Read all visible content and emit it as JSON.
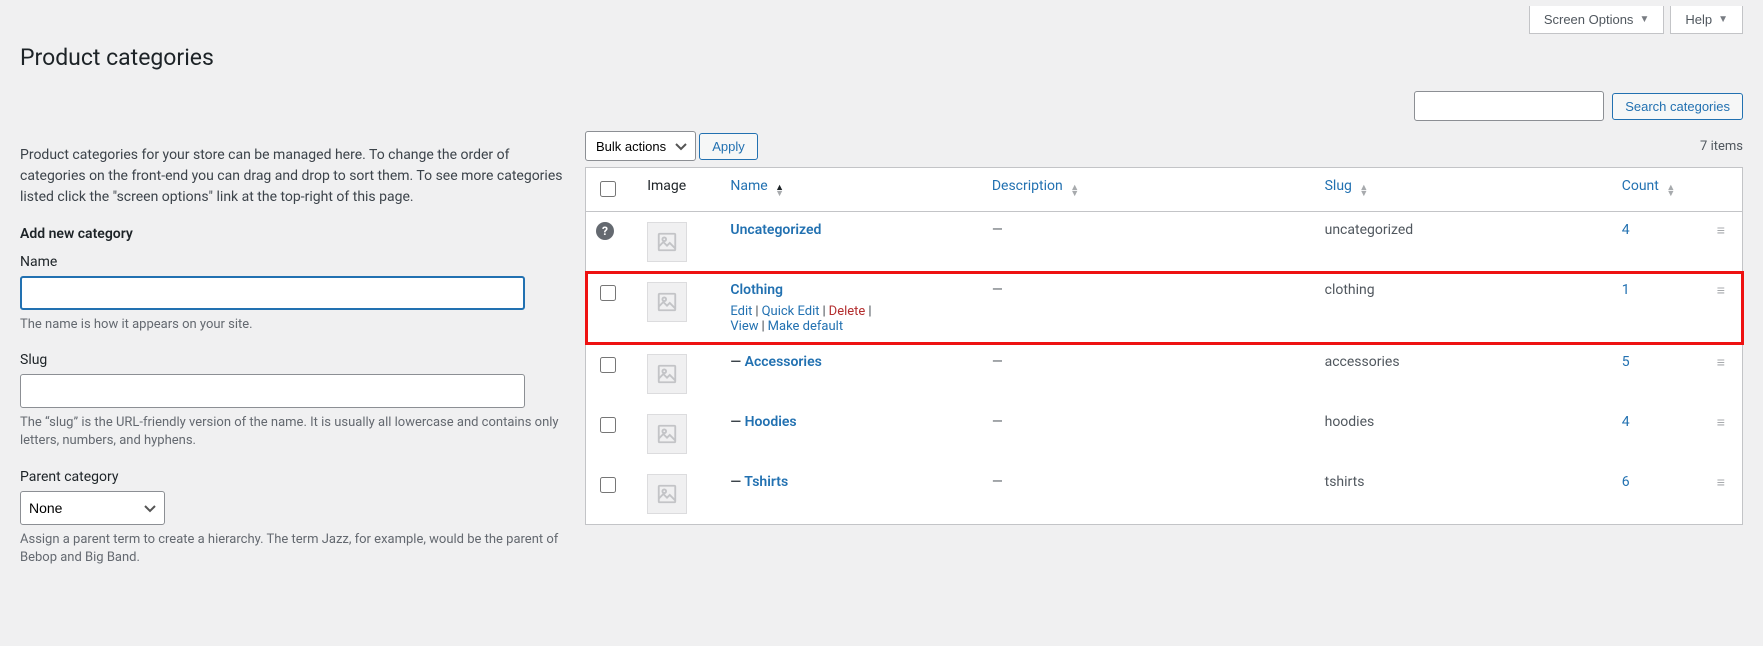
{
  "top": {
    "screen_options": "Screen Options",
    "help": "Help"
  },
  "page_title": "Product categories",
  "search": {
    "button": "Search categories"
  },
  "intro": "Product categories for your store can be managed here. To change the order of categories on the front-end you can drag and drop to sort them. To see more categories listed click the \"screen options\" link at the top-right of this page.",
  "form": {
    "heading": "Add new category",
    "name_label": "Name",
    "name_hint": "The name is how it appears on your site.",
    "slug_label": "Slug",
    "slug_hint": "The “slug” is the URL-friendly version of the name. It is usually all lowercase and contains only letters, numbers, and hyphens.",
    "parent_label": "Parent category",
    "parent_selected": "None",
    "parent_hint": "Assign a parent term to create a hierarchy. The term Jazz, for example, would be the parent of Bebop and Big Band."
  },
  "bulk": {
    "selected": "Bulk actions",
    "apply": "Apply"
  },
  "items_count": "7 items",
  "columns": {
    "image": "Image",
    "name": "Name",
    "description": "Description",
    "slug": "Slug",
    "count": "Count"
  },
  "row_actions": {
    "edit": "Edit",
    "quick_edit": "Quick Edit",
    "delete": "Delete",
    "view": "View",
    "make_default": "Make default"
  },
  "rows": [
    {
      "name": "Uncategorized",
      "prefix": "",
      "description": "—",
      "slug": "uncategorized",
      "count": "4",
      "default": true,
      "show_actions": false
    },
    {
      "name": "Clothing",
      "prefix": "",
      "description": "—",
      "slug": "clothing",
      "count": "1",
      "default": false,
      "show_actions": true,
      "highlight": true
    },
    {
      "name": "Accessories",
      "prefix": "— ",
      "description": "—",
      "slug": "accessories",
      "count": "5",
      "default": false,
      "show_actions": false
    },
    {
      "name": "Hoodies",
      "prefix": "— ",
      "description": "—",
      "slug": "hoodies",
      "count": "4",
      "default": false,
      "show_actions": false
    },
    {
      "name": "Tshirts",
      "prefix": "— ",
      "description": "—",
      "slug": "tshirts",
      "count": "6",
      "default": false,
      "show_actions": false
    }
  ]
}
